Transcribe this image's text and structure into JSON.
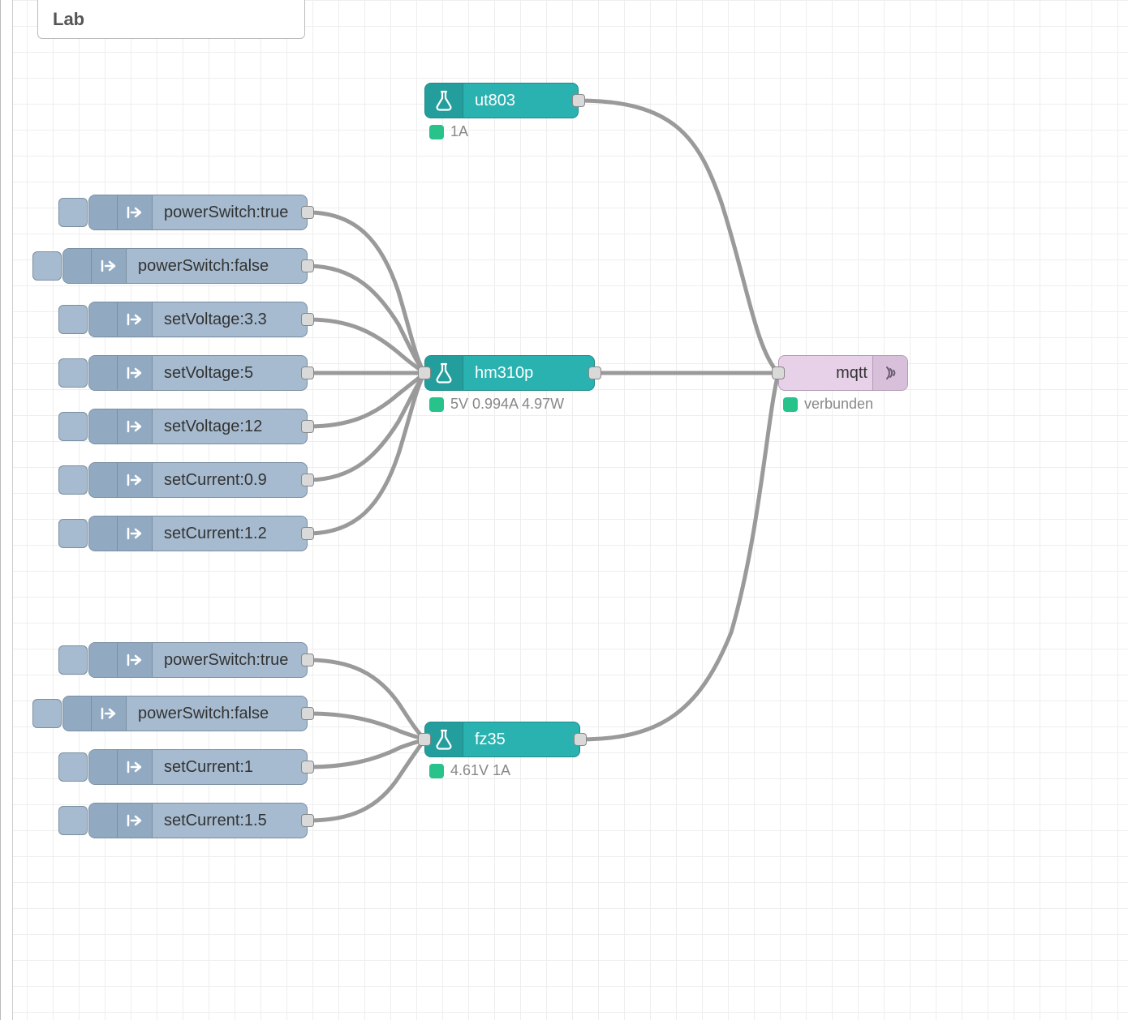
{
  "tab": {
    "label": "Lab"
  },
  "nodes": {
    "ut803": {
      "label": "ut803",
      "status": "1A"
    },
    "hm310p": {
      "label": "hm310p",
      "status": "5V 0.994A 4.97W"
    },
    "fz35": {
      "label": "fz35",
      "status": "4.61V 1A"
    },
    "mqtt": {
      "label": "mqtt",
      "status": "verbunden"
    }
  },
  "inject_group_hm310p": [
    {
      "label": "powerSwitch:true"
    },
    {
      "label": "powerSwitch:false"
    },
    {
      "label": "setVoltage:3.3"
    },
    {
      "label": "setVoltage:5"
    },
    {
      "label": "setVoltage:12"
    },
    {
      "label": "setCurrent:0.9"
    },
    {
      "label": "setCurrent:1.2"
    }
  ],
  "inject_group_fz35": [
    {
      "label": "powerSwitch:true"
    },
    {
      "label": "powerSwitch:false"
    },
    {
      "label": "setCurrent:1"
    },
    {
      "label": "setCurrent:1.5"
    }
  ]
}
